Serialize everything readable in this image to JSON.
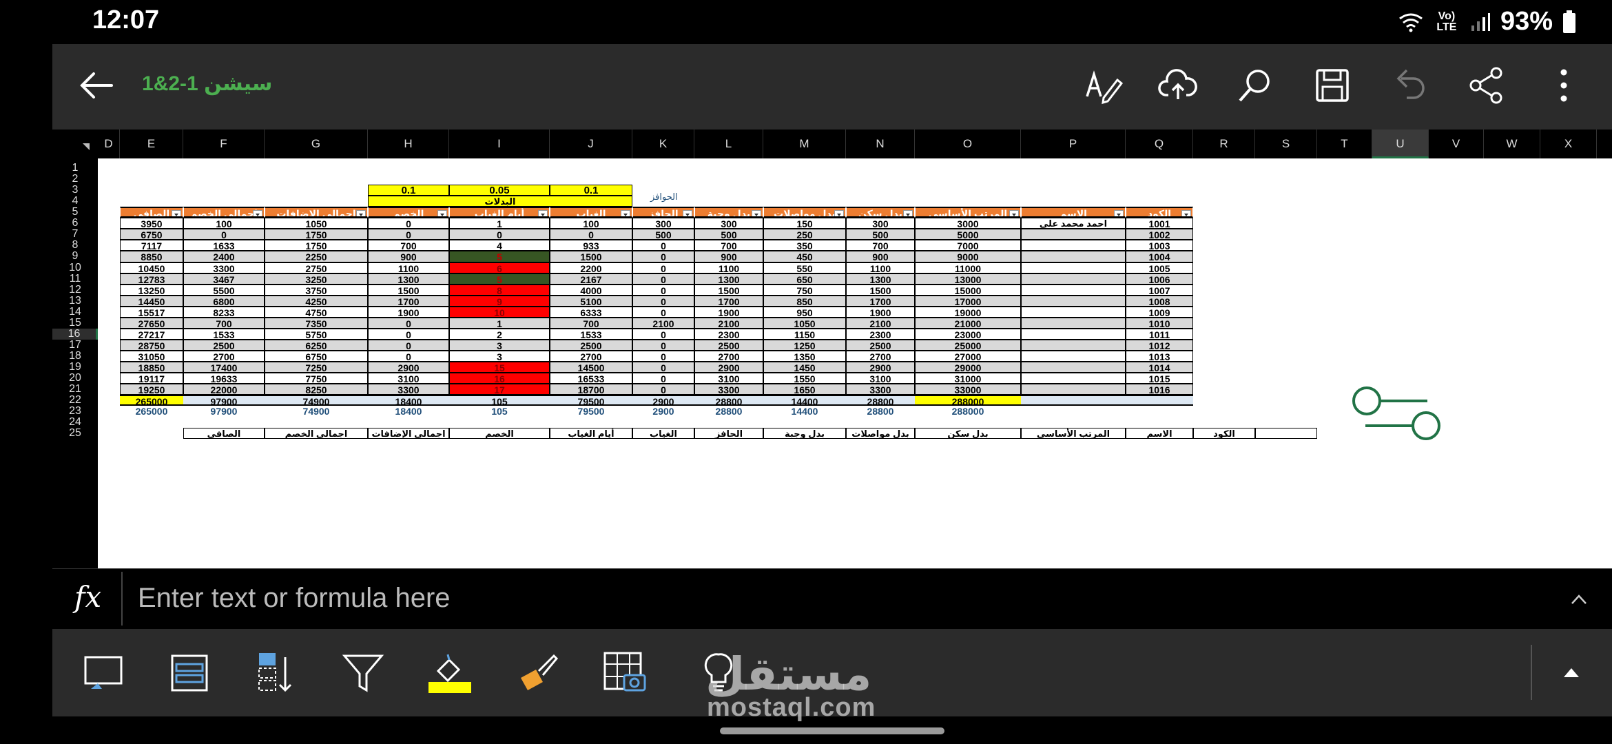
{
  "status_bar": {
    "time": "12:07",
    "battery": "93%",
    "network": "Vo) LTE"
  },
  "app_bar": {
    "title": "سيشن 1-2&1"
  },
  "toolbar": {
    "icons": [
      "draw-icon",
      "cloud-upload-icon",
      "search-icon",
      "save-icon",
      "undo-icon",
      "share-icon",
      "more-icon"
    ]
  },
  "columns": [
    "D",
    "E",
    "F",
    "G",
    "H",
    "I",
    "J",
    "K",
    "L",
    "M",
    "N",
    "O",
    "P",
    "Q",
    "R",
    "S",
    "T",
    "U",
    "V",
    "W",
    "X"
  ],
  "rows": [
    "1",
    "2",
    "3",
    "4",
    "5",
    "6",
    "7",
    "8",
    "9",
    "10",
    "11",
    "12",
    "13",
    "14",
    "15",
    "16",
    "17",
    "18",
    "19",
    "20",
    "21",
    "22",
    "23",
    "24",
    "25"
  ],
  "sheet": {
    "rates": [
      "0.1",
      "0.05",
      "0.1"
    ],
    "allowances_label": "البدلات",
    "incentives_label": "الحوافز",
    "headers": [
      "الكود",
      "الاسم",
      "المرتب الأساسي",
      "بدل سكن",
      "بدل مواصلات",
      "بدل وجبة",
      "الحافز",
      "الغياب",
      "أيام الغياب",
      "الخصم",
      "اجمالي الإضافات",
      "اجمالي الخصم",
      "الصافي"
    ],
    "data_rows": [
      [
        "1001",
        "احمد محمد على",
        "3000",
        "300",
        "150",
        "300",
        "300",
        "100",
        "1",
        "0",
        "1050",
        "100",
        "3950"
      ],
      [
        "1002",
        "",
        "5000",
        "500",
        "250",
        "500",
        "500",
        "0",
        "0",
        "0",
        "1750",
        "0",
        "6750"
      ],
      [
        "1003",
        "",
        "7000",
        "700",
        "350",
        "700",
        "0",
        "933",
        "4",
        "700",
        "1750",
        "1633",
        "7117"
      ],
      [
        "1004",
        "",
        "9000",
        "900",
        "450",
        "900",
        "0",
        "1500",
        "5",
        "900",
        "2250",
        "2400",
        "8850"
      ],
      [
        "1005",
        "",
        "11000",
        "1100",
        "550",
        "1100",
        "0",
        "2200",
        "6",
        "1100",
        "2750",
        "3300",
        "10450"
      ],
      [
        "1006",
        "",
        "13000",
        "1300",
        "650",
        "1300",
        "0",
        "2167",
        "5",
        "1300",
        "3250",
        "3467",
        "12783"
      ],
      [
        "1007",
        "",
        "15000",
        "1500",
        "750",
        "1500",
        "0",
        "4000",
        "8",
        "1500",
        "3750",
        "5500",
        "13250"
      ],
      [
        "1008",
        "",
        "17000",
        "1700",
        "850",
        "1700",
        "0",
        "5100",
        "9",
        "1700",
        "4250",
        "6800",
        "14450"
      ],
      [
        "1009",
        "",
        "19000",
        "1900",
        "950",
        "1900",
        "0",
        "6333",
        "10",
        "1900",
        "4750",
        "8233",
        "15517"
      ],
      [
        "1010",
        "",
        "21000",
        "2100",
        "1050",
        "2100",
        "2100",
        "700",
        "1",
        "0",
        "7350",
        "700",
        "27650"
      ],
      [
        "1011",
        "",
        "23000",
        "2300",
        "1150",
        "2300",
        "0",
        "1533",
        "2",
        "0",
        "5750",
        "1533",
        "27217"
      ],
      [
        "1012",
        "",
        "25000",
        "2500",
        "1250",
        "2500",
        "0",
        "2500",
        "3",
        "0",
        "6250",
        "2500",
        "28750"
      ],
      [
        "1013",
        "",
        "27000",
        "2700",
        "1350",
        "2700",
        "0",
        "2700",
        "3",
        "0",
        "6750",
        "2700",
        "31050"
      ],
      [
        "1014",
        "",
        "29000",
        "2900",
        "1450",
        "2900",
        "0",
        "14500",
        "15",
        "2900",
        "7250",
        "17400",
        "18850"
      ],
      [
        "1015",
        "",
        "31000",
        "3100",
        "1550",
        "3100",
        "0",
        "16533",
        "16",
        "3100",
        "7750",
        "19633",
        "19117"
      ],
      [
        "1016",
        "",
        "33000",
        "3300",
        "1650",
        "3300",
        "0",
        "18700",
        "17",
        "3300",
        "8250",
        "22000",
        "19250"
      ]
    ],
    "absence_colors": [
      "none",
      "none",
      "none",
      "dark-green",
      "red",
      "dark-green",
      "red",
      "red",
      "red",
      "none",
      "none",
      "none",
      "none",
      "red",
      "red",
      "red"
    ],
    "total_row": [
      "",
      "",
      "288000",
      "28800",
      "14400",
      "28800",
      "2900",
      "79500",
      "105",
      "18400",
      "74900",
      "97900",
      "265000"
    ],
    "subtotal_row": [
      "",
      "",
      "288000",
      "28800",
      "14400",
      "28800",
      "2900",
      "79500",
      "105",
      "18400",
      "74900",
      "97900",
      "265000"
    ],
    "row25_headers": [
      "الكود",
      "الاسم",
      "المرتب الأساسي",
      "بدل سكن",
      "بدل مواصلات",
      "بدل وجبة",
      "الحافز",
      "الغياب",
      "أيام الغياب",
      "الخصم",
      "اجمالي الإضافات",
      "اجمالي الخصم",
      "الصافي"
    ]
  },
  "formula_bar": {
    "fx": "fx",
    "placeholder": "Enter text or formula here"
  },
  "ribbon": {
    "icons": [
      "insert-shape-icon",
      "format-table-icon",
      "sort-icon",
      "filter-icon",
      "fill-color-icon",
      "format-painter-icon",
      "table-camera-icon",
      "ideas-icon"
    ]
  },
  "watermark": {
    "arabic": "مستقل",
    "latin": "mostaql.com"
  },
  "colors": {
    "header_orange": "#ed7d31",
    "rate_yellow": "#ffff00",
    "absence_red": "#ff0000",
    "absence_green": "#375623",
    "total_blue": "#1f4e79"
  }
}
